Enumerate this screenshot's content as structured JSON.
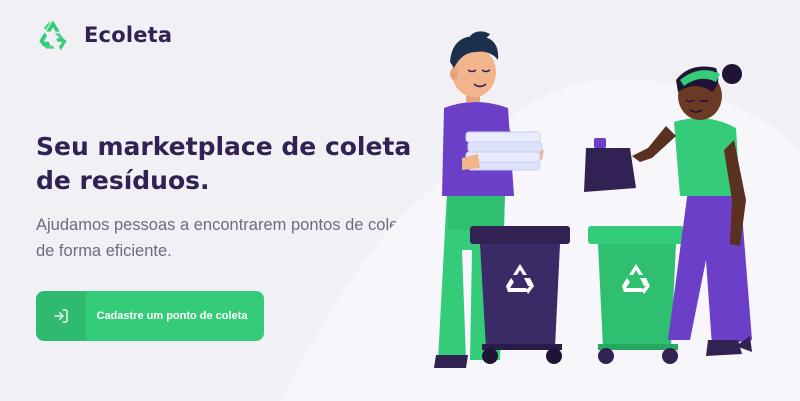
{
  "app": {
    "name": "Ecoleta",
    "logo_icon": "recycle-icon"
  },
  "hero": {
    "title": "Seu marketplace de coleta de resíduos.",
    "subtitle": "Ajudamos pessoas a encontrarem pontos de coleta de forma eficiente."
  },
  "cta": {
    "label": "Cadastre um ponto de coleta",
    "icon": "log-in-icon"
  },
  "colors": {
    "brand_green": "#34cb79",
    "title_purple": "#322153",
    "text_gray": "#6c6c80",
    "background": "#f0f0f5",
    "bin_dark": "#2e1f52",
    "shirt_purple": "#6c3fc8"
  }
}
